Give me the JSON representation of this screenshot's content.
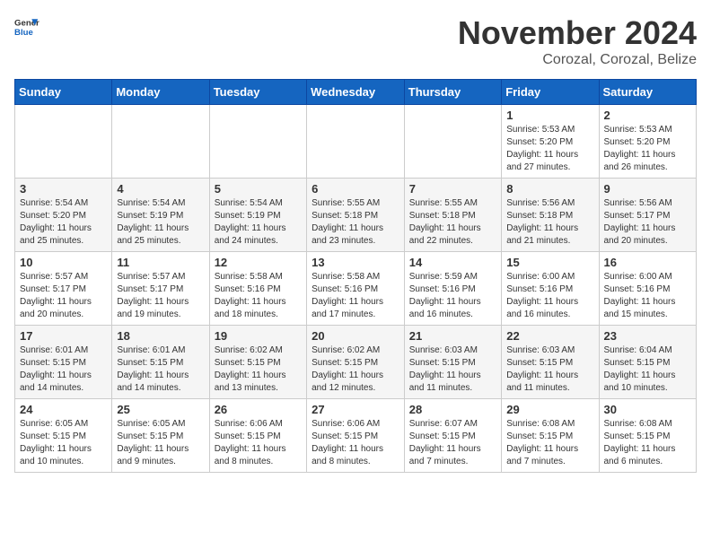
{
  "header": {
    "logo_general": "General",
    "logo_blue": "Blue",
    "month": "November 2024",
    "location": "Corozal, Corozal, Belize"
  },
  "weekdays": [
    "Sunday",
    "Monday",
    "Tuesday",
    "Wednesday",
    "Thursday",
    "Friday",
    "Saturday"
  ],
  "weeks": [
    [
      {
        "day": "",
        "info": ""
      },
      {
        "day": "",
        "info": ""
      },
      {
        "day": "",
        "info": ""
      },
      {
        "day": "",
        "info": ""
      },
      {
        "day": "",
        "info": ""
      },
      {
        "day": "1",
        "info": "Sunrise: 5:53 AM\nSunset: 5:20 PM\nDaylight: 11 hours\nand 27 minutes."
      },
      {
        "day": "2",
        "info": "Sunrise: 5:53 AM\nSunset: 5:20 PM\nDaylight: 11 hours\nand 26 minutes."
      }
    ],
    [
      {
        "day": "3",
        "info": "Sunrise: 5:54 AM\nSunset: 5:20 PM\nDaylight: 11 hours\nand 25 minutes."
      },
      {
        "day": "4",
        "info": "Sunrise: 5:54 AM\nSunset: 5:19 PM\nDaylight: 11 hours\nand 25 minutes."
      },
      {
        "day": "5",
        "info": "Sunrise: 5:54 AM\nSunset: 5:19 PM\nDaylight: 11 hours\nand 24 minutes."
      },
      {
        "day": "6",
        "info": "Sunrise: 5:55 AM\nSunset: 5:18 PM\nDaylight: 11 hours\nand 23 minutes."
      },
      {
        "day": "7",
        "info": "Sunrise: 5:55 AM\nSunset: 5:18 PM\nDaylight: 11 hours\nand 22 minutes."
      },
      {
        "day": "8",
        "info": "Sunrise: 5:56 AM\nSunset: 5:18 PM\nDaylight: 11 hours\nand 21 minutes."
      },
      {
        "day": "9",
        "info": "Sunrise: 5:56 AM\nSunset: 5:17 PM\nDaylight: 11 hours\nand 20 minutes."
      }
    ],
    [
      {
        "day": "10",
        "info": "Sunrise: 5:57 AM\nSunset: 5:17 PM\nDaylight: 11 hours\nand 20 minutes."
      },
      {
        "day": "11",
        "info": "Sunrise: 5:57 AM\nSunset: 5:17 PM\nDaylight: 11 hours\nand 19 minutes."
      },
      {
        "day": "12",
        "info": "Sunrise: 5:58 AM\nSunset: 5:16 PM\nDaylight: 11 hours\nand 18 minutes."
      },
      {
        "day": "13",
        "info": "Sunrise: 5:58 AM\nSunset: 5:16 PM\nDaylight: 11 hours\nand 17 minutes."
      },
      {
        "day": "14",
        "info": "Sunrise: 5:59 AM\nSunset: 5:16 PM\nDaylight: 11 hours\nand 16 minutes."
      },
      {
        "day": "15",
        "info": "Sunrise: 6:00 AM\nSunset: 5:16 PM\nDaylight: 11 hours\nand 16 minutes."
      },
      {
        "day": "16",
        "info": "Sunrise: 6:00 AM\nSunset: 5:16 PM\nDaylight: 11 hours\nand 15 minutes."
      }
    ],
    [
      {
        "day": "17",
        "info": "Sunrise: 6:01 AM\nSunset: 5:15 PM\nDaylight: 11 hours\nand 14 minutes."
      },
      {
        "day": "18",
        "info": "Sunrise: 6:01 AM\nSunset: 5:15 PM\nDaylight: 11 hours\nand 14 minutes."
      },
      {
        "day": "19",
        "info": "Sunrise: 6:02 AM\nSunset: 5:15 PM\nDaylight: 11 hours\nand 13 minutes."
      },
      {
        "day": "20",
        "info": "Sunrise: 6:02 AM\nSunset: 5:15 PM\nDaylight: 11 hours\nand 12 minutes."
      },
      {
        "day": "21",
        "info": "Sunrise: 6:03 AM\nSunset: 5:15 PM\nDaylight: 11 hours\nand 11 minutes."
      },
      {
        "day": "22",
        "info": "Sunrise: 6:03 AM\nSunset: 5:15 PM\nDaylight: 11 hours\nand 11 minutes."
      },
      {
        "day": "23",
        "info": "Sunrise: 6:04 AM\nSunset: 5:15 PM\nDaylight: 11 hours\nand 10 minutes."
      }
    ],
    [
      {
        "day": "24",
        "info": "Sunrise: 6:05 AM\nSunset: 5:15 PM\nDaylight: 11 hours\nand 10 minutes."
      },
      {
        "day": "25",
        "info": "Sunrise: 6:05 AM\nSunset: 5:15 PM\nDaylight: 11 hours\nand 9 minutes."
      },
      {
        "day": "26",
        "info": "Sunrise: 6:06 AM\nSunset: 5:15 PM\nDaylight: 11 hours\nand 8 minutes."
      },
      {
        "day": "27",
        "info": "Sunrise: 6:06 AM\nSunset: 5:15 PM\nDaylight: 11 hours\nand 8 minutes."
      },
      {
        "day": "28",
        "info": "Sunrise: 6:07 AM\nSunset: 5:15 PM\nDaylight: 11 hours\nand 7 minutes."
      },
      {
        "day": "29",
        "info": "Sunrise: 6:08 AM\nSunset: 5:15 PM\nDaylight: 11 hours\nand 7 minutes."
      },
      {
        "day": "30",
        "info": "Sunrise: 6:08 AM\nSunset: 5:15 PM\nDaylight: 11 hours\nand 6 minutes."
      }
    ]
  ]
}
